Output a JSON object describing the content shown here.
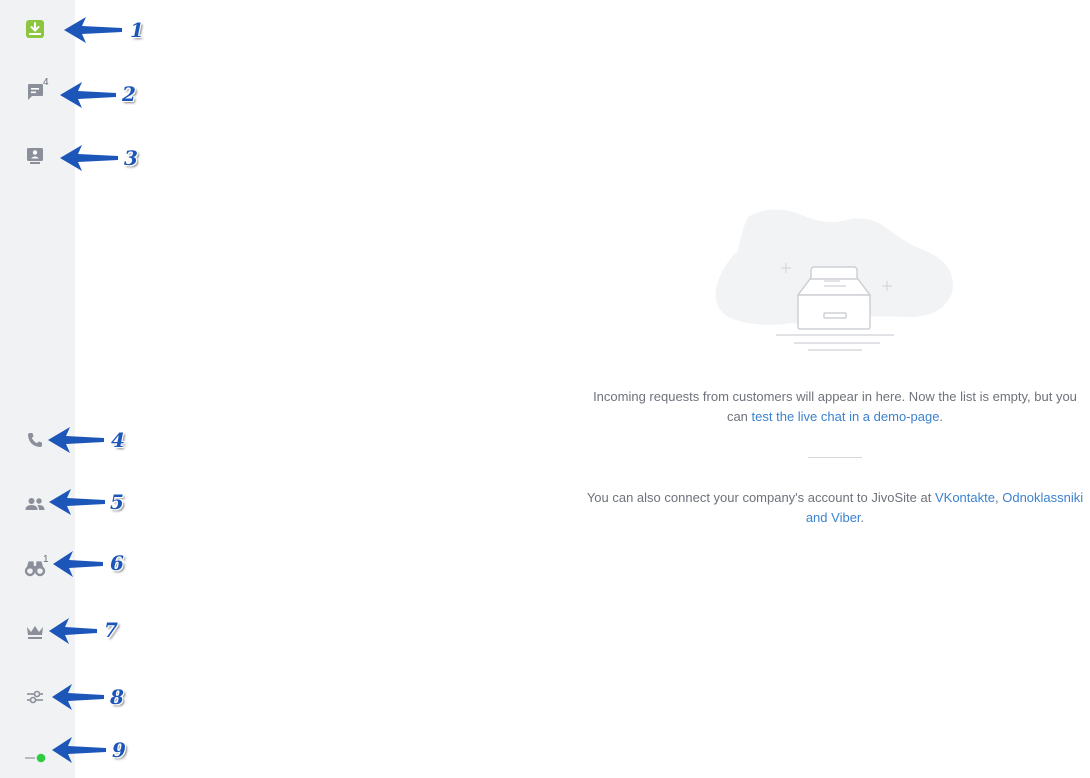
{
  "sidebar": {
    "items": [
      {
        "icon": "download-box-icon",
        "badge": ""
      },
      {
        "icon": "chat-bubble-icon",
        "badge": "4"
      },
      {
        "icon": "contact-card-icon",
        "badge": ""
      },
      {
        "icon": "phone-icon",
        "badge": ""
      },
      {
        "icon": "people-icon",
        "badge": ""
      },
      {
        "icon": "binoculars-icon",
        "badge": "1"
      },
      {
        "icon": "crown-icon",
        "badge": ""
      },
      {
        "icon": "settings-sliders-icon",
        "badge": ""
      },
      {
        "icon": "status-online-icon",
        "badge": ""
      }
    ],
    "accent_color": "#8cc63f",
    "online_color": "#2ecc40"
  },
  "annotations": [
    "1",
    "2",
    "3",
    "4",
    "5",
    "6",
    "7",
    "8",
    "9"
  ],
  "empty_state": {
    "line1_text": "Incoming requests from customers will appear in here. Now the list is empty, but you can",
    "line1_link": "test the live chat in a demo-page",
    "line1_end": ".",
    "line2_text": "You can also connect your company's account to JivoSite at",
    "link_vk": "VKontakte",
    "sep1": ",",
    "link_ok": "Odnoklassniki",
    "and_word": "and",
    "link_viber": "Viber",
    "line2_end": "."
  }
}
